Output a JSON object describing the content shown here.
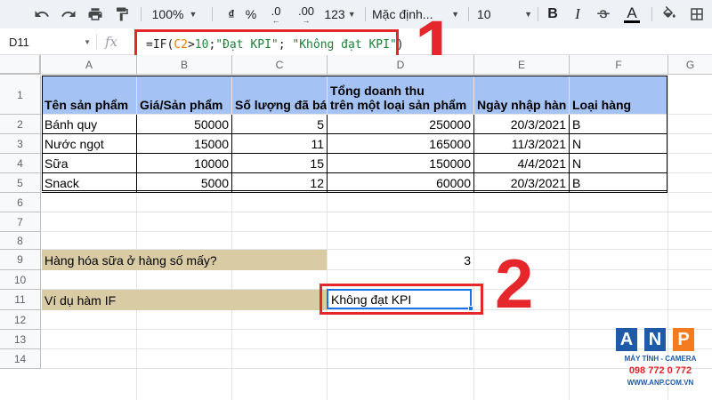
{
  "toolbar": {
    "zoom": "100%",
    "currency": "₫",
    "percent": "%",
    "decimal_decrease": ".0",
    "decimal_increase": ".00",
    "number_format": "123",
    "font_family": "Mặc định...",
    "font_size": "10",
    "bold": "B",
    "italic": "I",
    "text_color": "A"
  },
  "formula_bar": {
    "name_box": "D11",
    "fx": "fx",
    "formula_prefix": "=IF(",
    "formula_ref": "C2",
    "formula_op": ">",
    "formula_num": "10",
    "formula_sep1": ";",
    "formula_true": "\"Đạt KPI\"",
    "formula_sep2": "; ",
    "formula_false": "\"Không đạt KPI\"",
    "formula_close": ")"
  },
  "callouts": {
    "one": "1",
    "two": "2"
  },
  "columns": [
    "A",
    "B",
    "C",
    "D",
    "E",
    "F",
    "G"
  ],
  "rows": [
    "1",
    "2",
    "3",
    "4",
    "5",
    "6",
    "7",
    "8",
    "9",
    "10",
    "11",
    "12",
    "13",
    "14"
  ],
  "table": {
    "headers": [
      "Tên sản phẩm",
      "Giá/Sản phẩm",
      "Số lượng đã bá",
      "Tổng doanh thu",
      "trên một loại sản phẩm",
      "Ngày nhập hàn",
      "Loại hàng"
    ],
    "rows": [
      [
        "Bánh quy",
        "50000",
        "5",
        "250000",
        "20/3/2021",
        "B"
      ],
      [
        "Nước ngọt",
        "15000",
        "11",
        "165000",
        "11/3/2021",
        "N"
      ],
      [
        "Sữa",
        "10000",
        "15",
        "150000",
        "4/4/2021",
        "N"
      ],
      [
        "Snack",
        "5000",
        "12",
        "60000",
        "20/3/2021",
        "B"
      ]
    ]
  },
  "row9": {
    "label": "Hàng hóa sữa ở hàng số mấy?",
    "value": "3"
  },
  "row11": {
    "label": "Ví dụ hàm IF",
    "value": "Không đạt KPI"
  },
  "logo": {
    "letters": [
      "A",
      "N",
      "P"
    ],
    "tagline": "MÁY TÍNH - CAMERA",
    "phone": "098 772 0 772",
    "website": "WWW.ANP.COM.VN"
  },
  "colors": {
    "header_fill": "#a4c2f4",
    "label_fill": "#d9cba4",
    "highlight_red": "#e5262b",
    "selection_blue": "#1a73e8",
    "logo_blue": "#1e5aa8",
    "logo_orange": "#f47b20"
  }
}
